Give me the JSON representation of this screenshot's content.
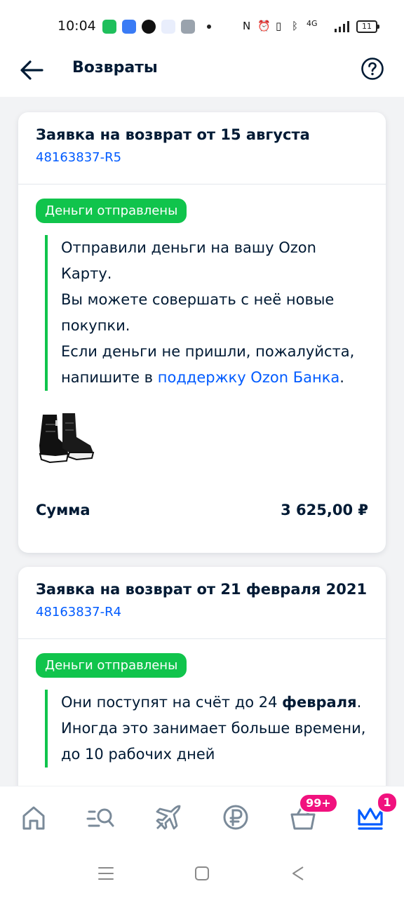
{
  "status_bar": {
    "time": "10:04",
    "network": "4G",
    "battery": "11",
    "icons": [
      "battery-saver-app-icon",
      "app-icon",
      "ring-app-icon",
      "detmir-app-icon",
      "settings-app-icon",
      "nfc-icon",
      "alarm-icon",
      "vibrate-icon",
      "bluetooth-icon",
      "signal-icon",
      "battery-icon"
    ]
  },
  "header": {
    "title": "Возвраты",
    "back_icon": "arrow-left-icon",
    "help_icon": "question-icon"
  },
  "returns": [
    {
      "title": "Заявка на возврат от 15 августа",
      "id": "48163837-R5",
      "status": "Деньги отправлены",
      "note_1": "Отправили деньги на вашу Ozon Карту.",
      "note_2": "Вы можете совершать с неё новые покупки.",
      "note_3": "Если деньги не пришли, пожалуйста, напишите в ",
      "note_link": "поддержку Ozon Банка",
      "note_end": ".",
      "product_icon": "winter-boots-image",
      "sum_label": "Сумма",
      "sum_value": "3 625,00 ₽"
    },
    {
      "title": "Заявка на возврат от 21 февраля 2021",
      "id": "48163837-R4",
      "status": "Деньги отправлены",
      "note_1": "Они поступят на счёт до 24 ",
      "note_bold": "февраля",
      "note_2": ".",
      "note_3": "Иногда это занимает больше времени, до 10 рабочих дней"
    }
  ],
  "bottom_nav": {
    "items": [
      "home-icon",
      "catalog-search-icon",
      "travel-plane-icon",
      "finance-ruble-icon",
      "cart-icon",
      "profile-crown-icon"
    ],
    "cart_badge": "99+",
    "profile_badge": "1",
    "active_color": "#005bff"
  },
  "colors": {
    "accent": "#005bff",
    "success": "#10c44c",
    "badge": "#f1117e",
    "text": "#001a34"
  }
}
